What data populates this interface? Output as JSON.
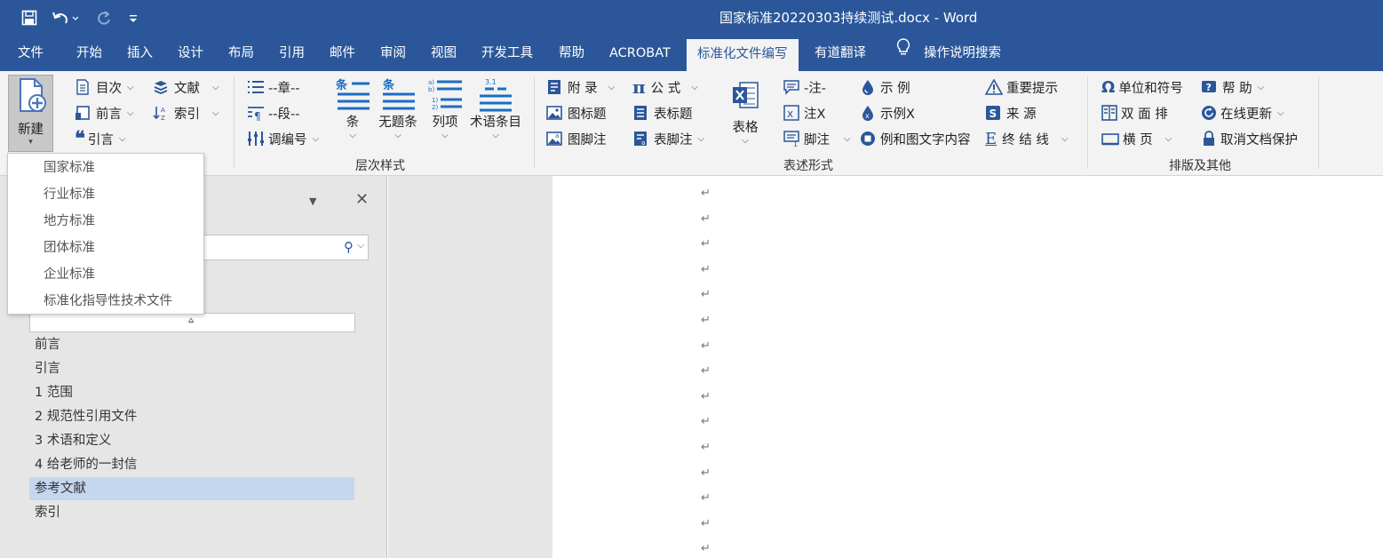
{
  "titlebar": {
    "title": "国家标准20220303持续测试.docx  -  Word",
    "qat": [
      "save-icon",
      "undo-icon",
      "redo-icon",
      "customize-icon"
    ]
  },
  "tabs": [
    "文件",
    "开始",
    "插入",
    "设计",
    "布局",
    "引用",
    "邮件",
    "审阅",
    "视图",
    "开发工具",
    "帮助",
    "ACROBAT",
    "标准化文件编写",
    "有道翻译",
    "操作说明搜索"
  ],
  "ribbon": {
    "new_label": "新建",
    "group1": {
      "toc": "目次",
      "biblio": "文献",
      "foreword": "前言",
      "index": "索引",
      "intro": "引言"
    },
    "group2": {
      "chapter": "--章--",
      "segment": "--段--",
      "renumber": "调编号",
      "clause": "条",
      "untitled_clause": "无题条",
      "list_item": "列项",
      "term_item": "术语条目",
      "label": "层次样式"
    },
    "group3": {
      "appendix": "附  录",
      "formula": "公  式",
      "fig_title": "图标题",
      "table_title": "表标题",
      "fig_footnote": "图脚注",
      "table_footnote": "表脚注",
      "table": "表格",
      "note": "-注-",
      "notex": "注X",
      "footnote": "脚注",
      "example": "示  例",
      "examplex": "示例X",
      "example_fig_text": "例和图文字内容",
      "important": "重要提示",
      "source": "来    源",
      "end_line": "终 结 线",
      "label": "表述形式"
    },
    "group4": {
      "units": "单位和符号",
      "help": "帮    助",
      "double_row": "双 面 排",
      "online_update": "在线更新",
      "landscape": "横    页",
      "unprotect": "取消文档保护",
      "label": "排版及其他"
    }
  },
  "dropdown": [
    "国家标准",
    "行业标准",
    "地方标准",
    "团体标准",
    "企业标准",
    "标准化指导性技术文件"
  ],
  "nav_items": [
    "前言",
    "引言",
    "1    范围",
    "2    规范性引用文件",
    "3    术语和定义",
    "4    给老师的一封信",
    "参考文献",
    "索引"
  ],
  "nav_selected": "参考文献",
  "para_mark": "↵",
  "colors": {
    "brand": "#2b579a",
    "ribbon": "#f3f3f3",
    "selected": "#c5d7ef"
  }
}
